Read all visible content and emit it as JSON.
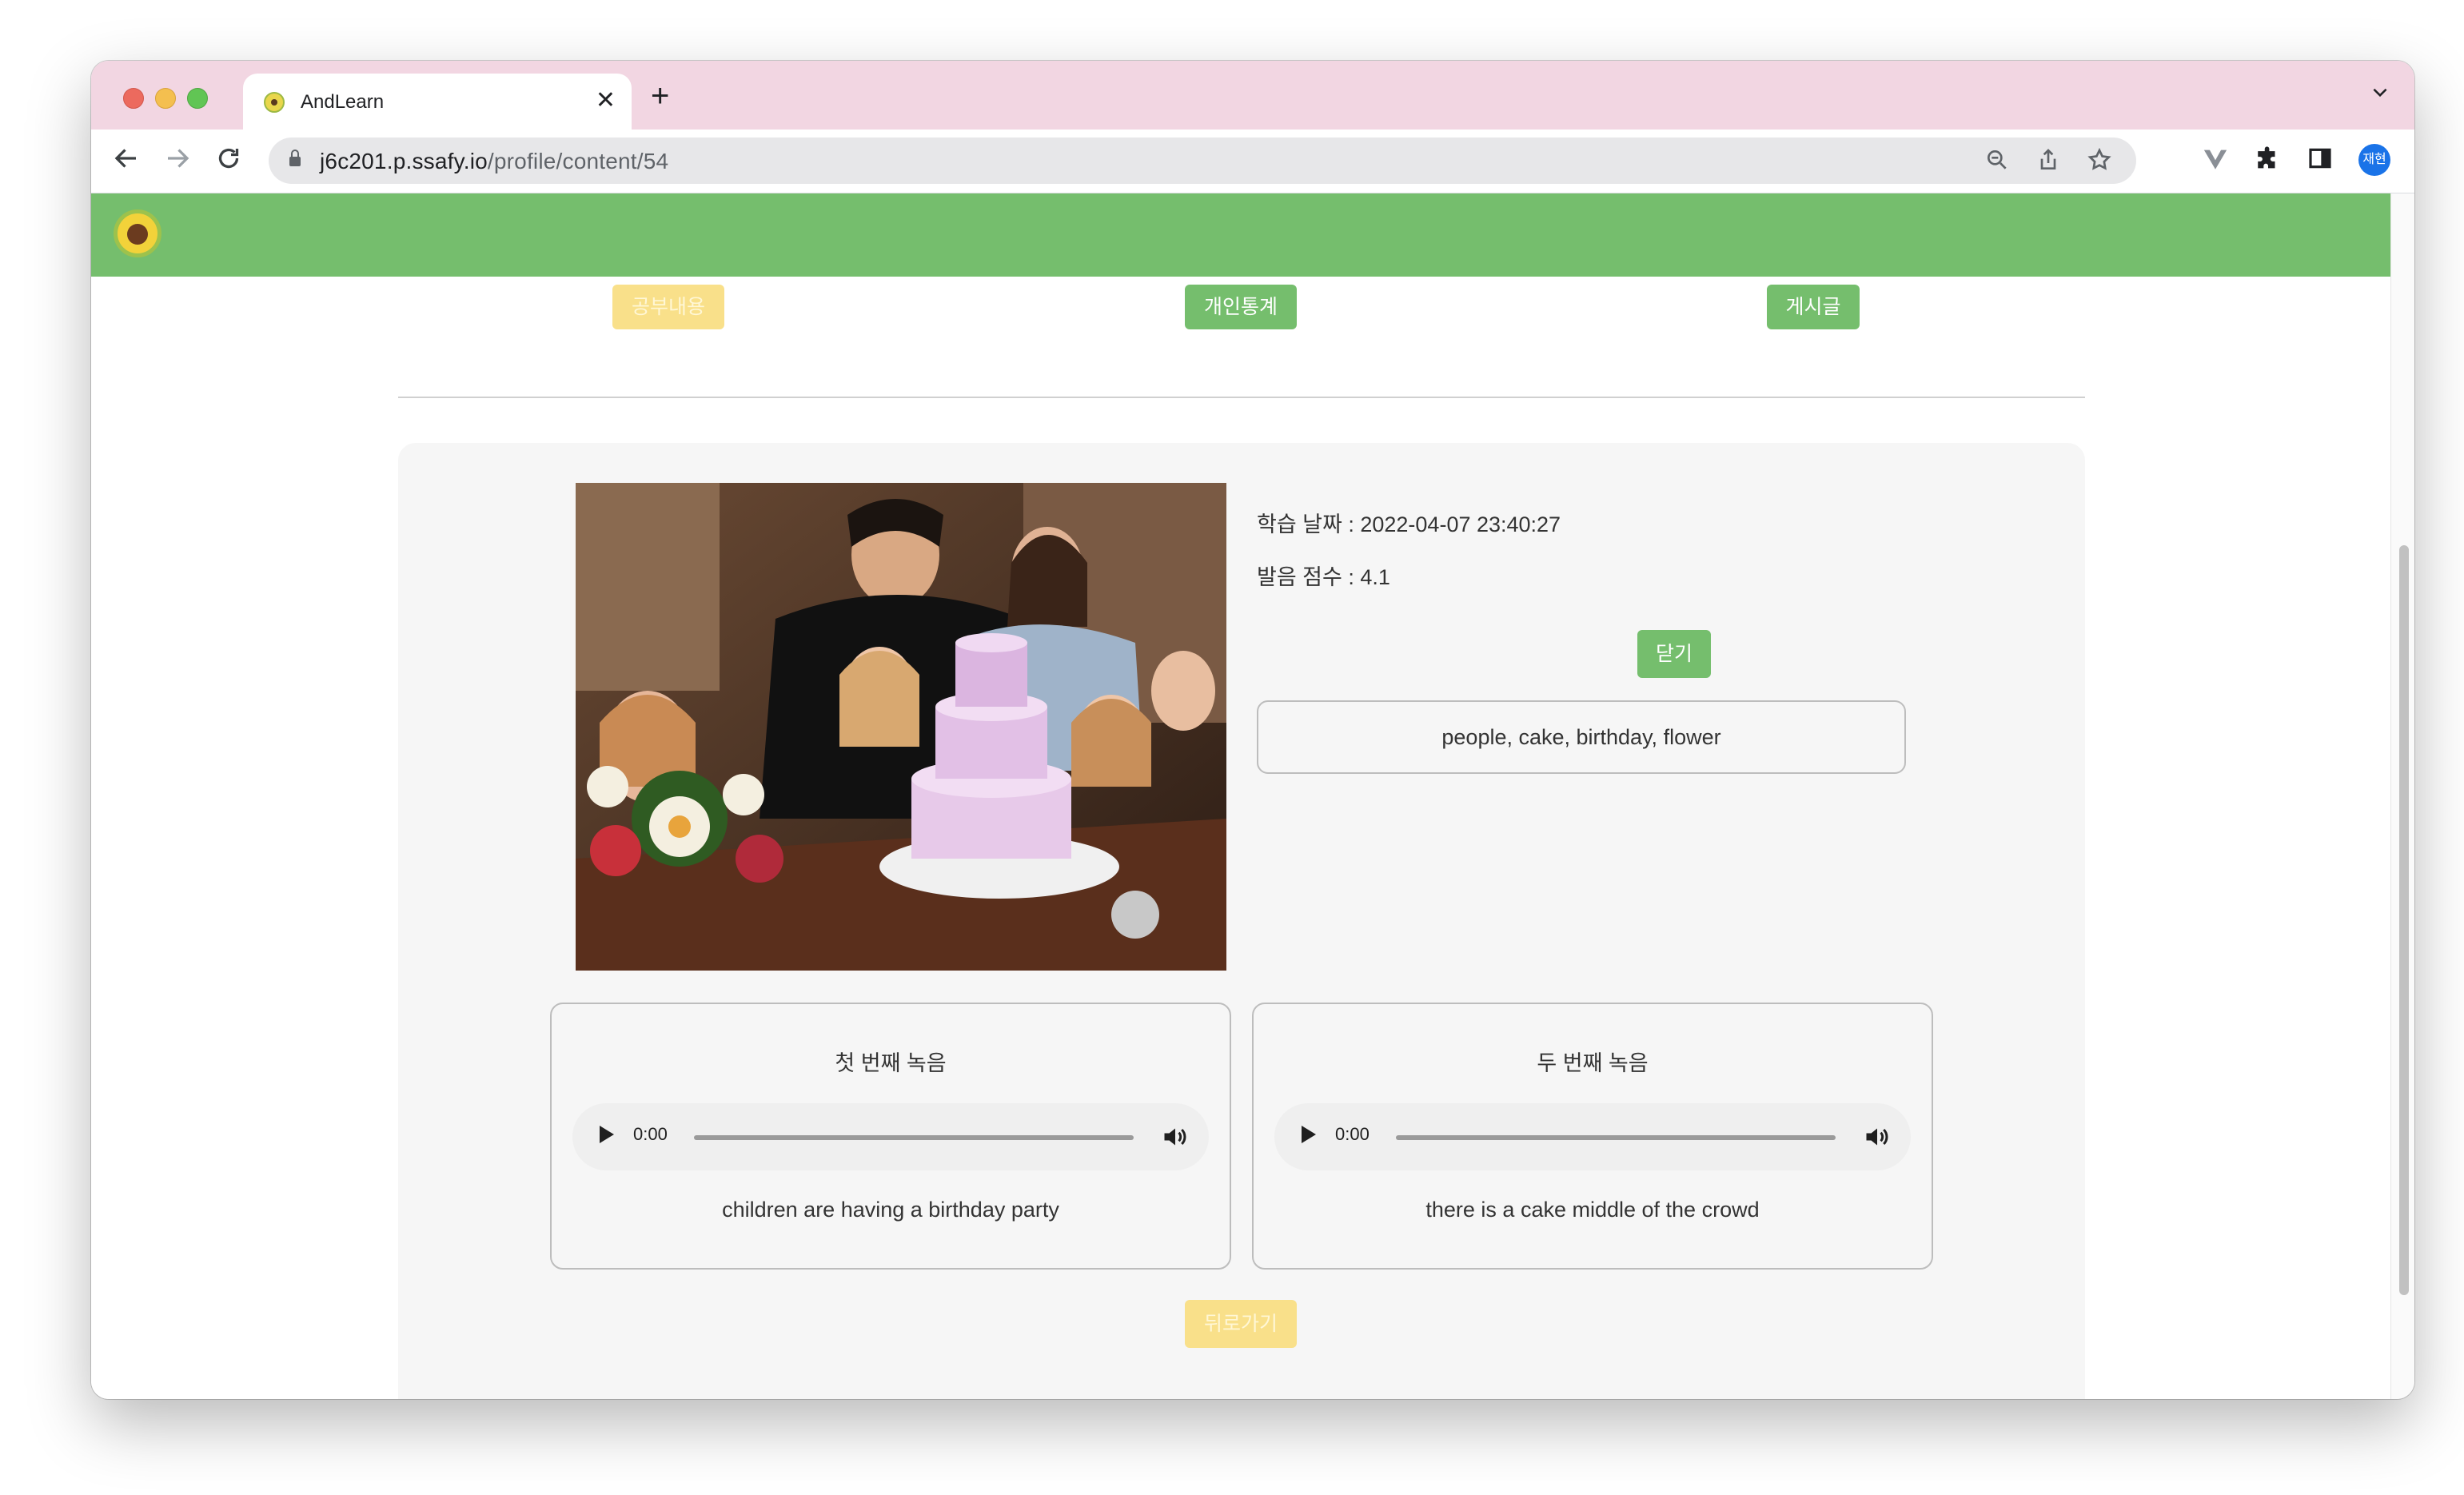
{
  "browser": {
    "tab_title": "AndLearn",
    "tab_close": "✕",
    "new_tab": "+",
    "tab_menu": "⌄",
    "url_host": "j6c201.p.ssafy.io",
    "url_path": "/profile/content/54",
    "profile_initials": "재현",
    "icons": [
      "back-icon",
      "forward-icon",
      "reload-icon",
      "lock-icon",
      "zoom-icon",
      "share-icon",
      "star-icon",
      "vue-devtools-icon",
      "extensions-icon",
      "sidepanel-icon",
      "menu-icon"
    ]
  },
  "colors": {
    "brand_green": "#75be6d",
    "brand_yellow": "#f9e08a",
    "tab_strip": "#f2d6e2",
    "card_bg": "#f6f6f6"
  },
  "nav": {
    "study": "공부내용",
    "stats": "개인통계",
    "board": "게시글"
  },
  "content": {
    "date_label": "학습 날짜 : 2022-04-07 23:40:27",
    "score_label": "발음 점수 : 4.1",
    "close_button": "닫기",
    "keywords": "people, cake, birthday, flower"
  },
  "recordings": [
    {
      "title": "첫 번째 녹음",
      "time": "0:00",
      "transcript": "children are having a birthday party",
      "progress": 0
    },
    {
      "title": "두 번째 녹음",
      "time": "0:00",
      "transcript": "there is a cake middle of the crowd",
      "progress": 0
    }
  ],
  "back_button": "뒤로가기"
}
